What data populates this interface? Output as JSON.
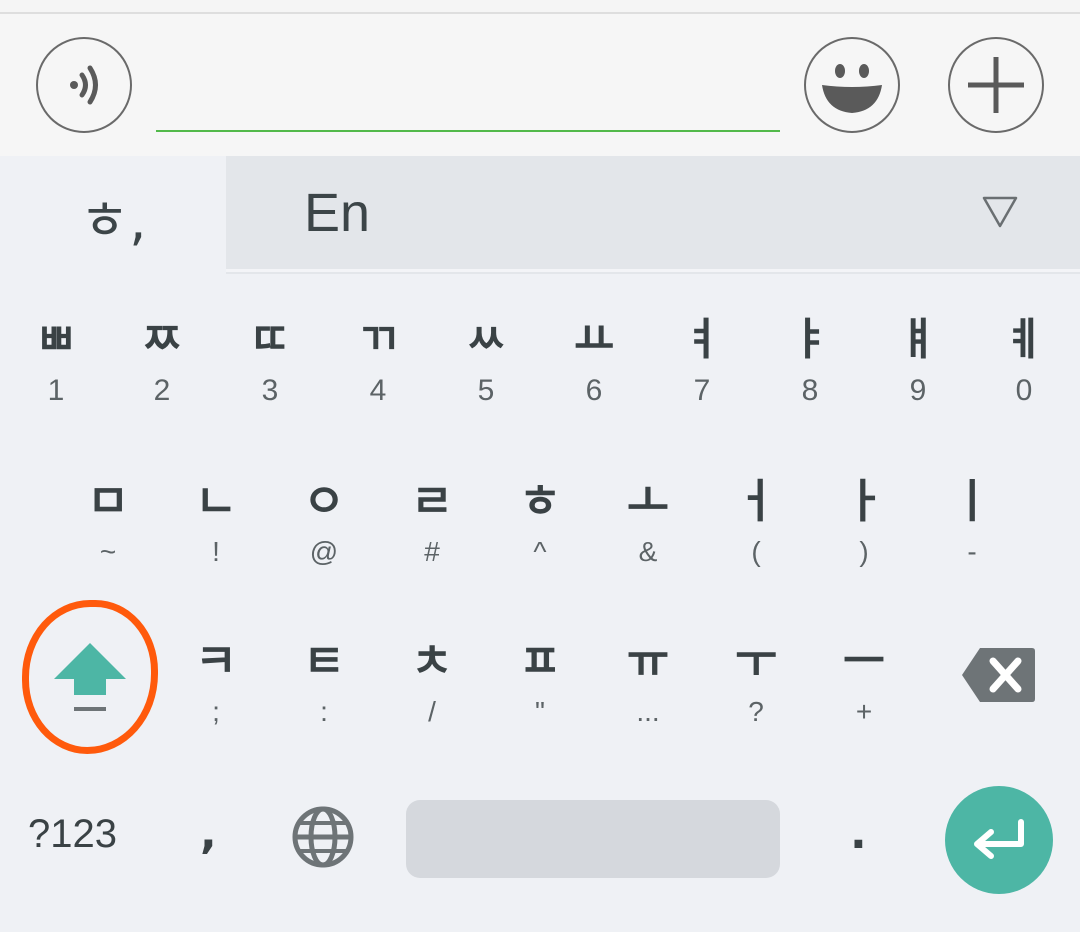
{
  "input": {
    "value": "",
    "placeholder": ""
  },
  "language_bar": {
    "korean_label": "ㅎ,",
    "english_label": "En"
  },
  "keyboard": {
    "row1": [
      {
        "main": "ㅃ",
        "sub": "1"
      },
      {
        "main": "ㅉ",
        "sub": "2"
      },
      {
        "main": "ㄸ",
        "sub": "3"
      },
      {
        "main": "ㄲ",
        "sub": "4"
      },
      {
        "main": "ㅆ",
        "sub": "5"
      },
      {
        "main": "ㅛ",
        "sub": "6"
      },
      {
        "main": "ㅕ",
        "sub": "7"
      },
      {
        "main": "ㅑ",
        "sub": "8"
      },
      {
        "main": "ㅒ",
        "sub": "9"
      },
      {
        "main": "ㅖ",
        "sub": "0"
      }
    ],
    "row2": [
      {
        "main": "ㅁ",
        "sub": "~"
      },
      {
        "main": "ㄴ",
        "sub": "!"
      },
      {
        "main": "ㅇ",
        "sub": "@"
      },
      {
        "main": "ㄹ",
        "sub": "#"
      },
      {
        "main": "ㅎ",
        "sub": "^"
      },
      {
        "main": "ㅗ",
        "sub": "&"
      },
      {
        "main": "ㅓ",
        "sub": "("
      },
      {
        "main": "ㅏ",
        "sub": ")"
      },
      {
        "main": "ㅣ",
        "sub": "-"
      }
    ],
    "row3": [
      {
        "main": "ㅋ",
        "sub": ";"
      },
      {
        "main": "ㅌ",
        "sub": ":"
      },
      {
        "main": "ㅊ",
        "sub": "/"
      },
      {
        "main": "ㅍ",
        "sub": "\""
      },
      {
        "main": "ㅠ",
        "sub": "..."
      },
      {
        "main": "ㅜ",
        "sub": "?"
      },
      {
        "main": "ㅡ",
        "sub": "+"
      }
    ],
    "bottom": {
      "symbols_label": "?123",
      "comma_label": ",",
      "period_label": "."
    }
  },
  "colors": {
    "accent": "#4db6a5",
    "input_underline": "#52b94a",
    "annotation": "#ff5a0c",
    "background": "#eff1f5"
  },
  "icons": {
    "voice": "voice-message-icon",
    "emoji": "smiley-icon",
    "attach": "plus-icon",
    "dropdown": "triangle-down-icon",
    "shift": "shift-arrow-icon",
    "backspace": "backspace-icon",
    "globe": "globe-icon",
    "enter": "enter-icon"
  }
}
